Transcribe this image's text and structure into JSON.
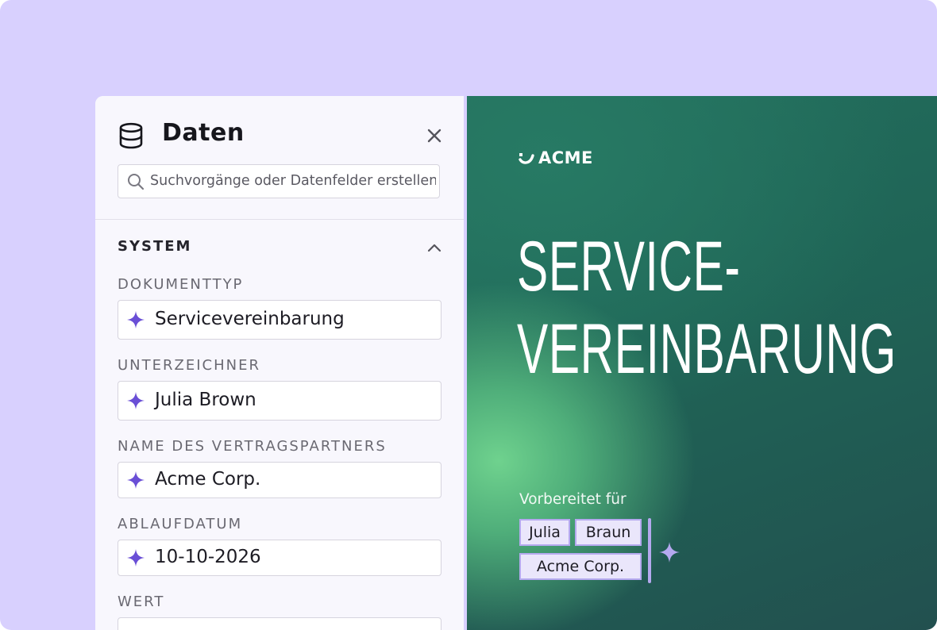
{
  "panel": {
    "title": "Daten",
    "icons": {
      "title": "database-icon",
      "close": "close-icon",
      "search": "search-icon",
      "collapse": "chevron-up-icon",
      "field": "sparkle-icon"
    },
    "search_placeholder": "Suchvorgänge oder Datenfelder erstellen",
    "section": {
      "title": "SYSTEM",
      "fields": [
        {
          "label": "DOKUMENTTYP",
          "value": "Servicevereinbarung"
        },
        {
          "label": "UNTERZEICHNER",
          "value": "Julia Brown"
        },
        {
          "label": "NAME DES VERTRAGSPARTNERS",
          "value": "Acme Corp."
        },
        {
          "label": "ABLAUFDATUM",
          "value": "10-10-2026"
        },
        {
          "label": "WERT",
          "value": ""
        }
      ]
    }
  },
  "document": {
    "logo_text": "ACME",
    "title_line1": "SERVICE-",
    "title_line2": "VEREINBARUNG",
    "prepared_label": "Vorbereitet für",
    "chips": {
      "first_name": "Julia",
      "last_name": "Braun",
      "company": "Acme Corp."
    }
  },
  "colors": {
    "frame_bg": "#d8d0fe",
    "accent_purple": "#6a4fd6",
    "doc_green": "#236f5d",
    "chip_border": "#b5a9ef"
  }
}
